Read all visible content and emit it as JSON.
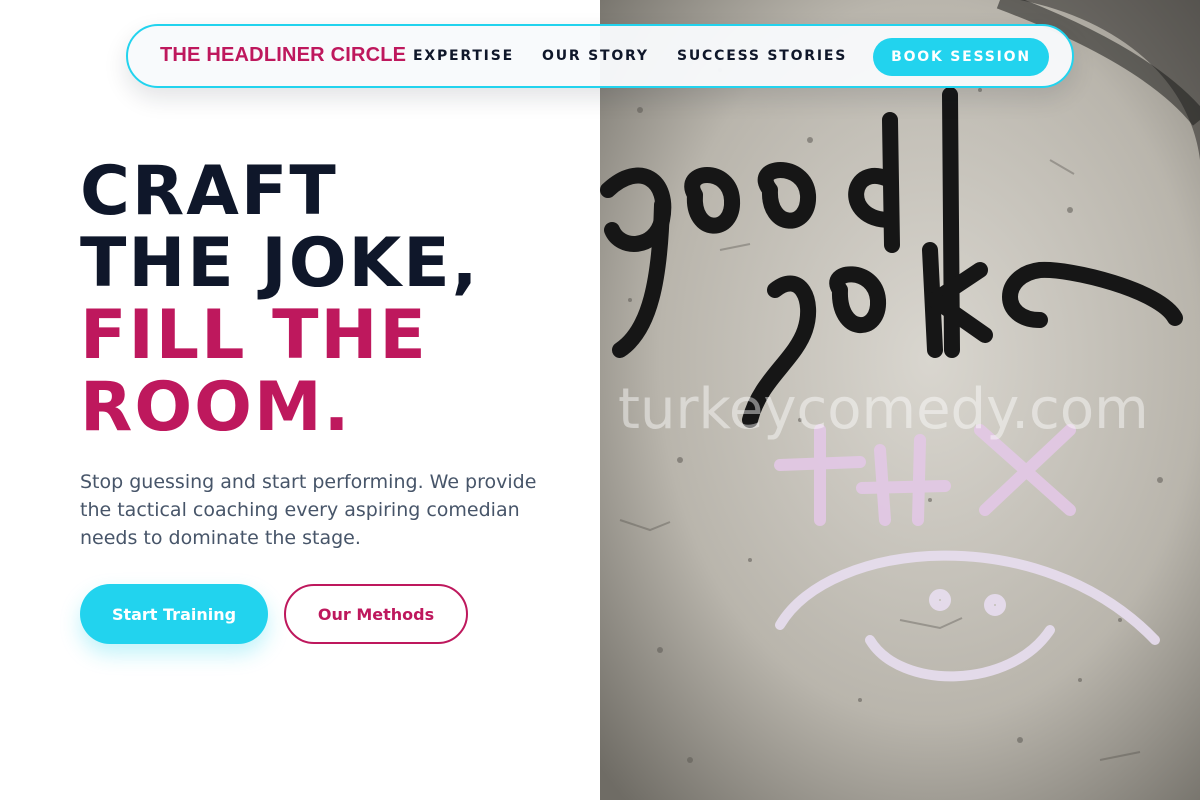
{
  "nav": {
    "brand": "THE HEADLINER CIRCLE",
    "links": [
      {
        "label": "EXPERTISE"
      },
      {
        "label": "OUR STORY"
      },
      {
        "label": "SUCCESS STORIES"
      }
    ],
    "cta_label": "BOOK SESSION"
  },
  "hero": {
    "title_line1": "CRAFT",
    "title_line2": "THE JOKE,",
    "title_line3": "FILL THE",
    "title_line4": "ROOM.",
    "description": "Stop guessing and start performing. We provide the tactical coaching every aspiring comedian needs to dominate the stage.",
    "primary_button": "Start Training",
    "secondary_button": "Our Methods"
  },
  "photo": {
    "graffiti_line1": "good",
    "graffiti_line2": "joke",
    "pink_scribble": "+HX",
    "watermark": "turkeycomedy.com"
  },
  "colors": {
    "accent_cyan": "#22d3ee",
    "accent_magenta": "#be185d",
    "heading_dark": "#0f172a",
    "body_text": "#475569"
  }
}
